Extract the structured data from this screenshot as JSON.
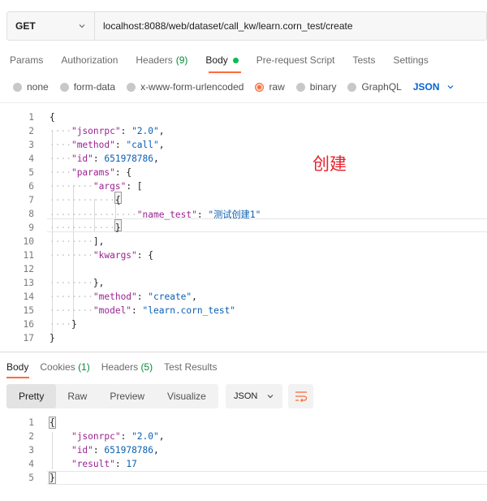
{
  "request": {
    "method": "GET",
    "url": "localhost:8088/web/dataset/call_kw/learn.corn_test/create"
  },
  "request_tabs": [
    {
      "label": "Params"
    },
    {
      "label": "Authorization"
    },
    {
      "label": "Headers",
      "count": "(9)"
    },
    {
      "label": "Body"
    },
    {
      "label": "Pre-request Script"
    },
    {
      "label": "Tests"
    },
    {
      "label": "Settings"
    }
  ],
  "body_types": {
    "none": "none",
    "form_data": "form-data",
    "urlencoded": "x-www-form-urlencoded",
    "raw": "raw",
    "binary": "binary",
    "graphql": "GraphQL",
    "language": "JSON"
  },
  "request_body": {
    "line_numbers": [
      "1",
      "2",
      "3",
      "4",
      "5",
      "6",
      "7",
      "8",
      "9",
      "10",
      "11",
      "12",
      "13",
      "14",
      "15",
      "16",
      "17"
    ],
    "jsonrpc_key": "\"jsonrpc\"",
    "jsonrpc_val": "\"2.0\"",
    "method_key": "\"method\"",
    "method_val": "\"call\"",
    "id_key": "\"id\"",
    "id_val": "651978786",
    "params_key": "\"params\"",
    "args_key": "\"args\"",
    "name_test_key": "\"name_test\"",
    "name_test_val": "\"测试创建1\"",
    "kwargs_key": "\"kwargs\"",
    "inner_method_key": "\"method\"",
    "inner_method_val": "\"create\"",
    "model_key": "\"model\"",
    "model_val": "\"learn.corn_test\""
  },
  "annotation": "创建",
  "response_tabs": [
    {
      "label": "Body"
    },
    {
      "label": "Cookies",
      "count": "(1)"
    },
    {
      "label": "Headers",
      "count": "(5)"
    },
    {
      "label": "Test Results"
    }
  ],
  "response_toolbar": {
    "views": [
      "Pretty",
      "Raw",
      "Preview",
      "Visualize"
    ],
    "format": "JSON"
  },
  "response_body": {
    "line_numbers": [
      "1",
      "2",
      "3",
      "4",
      "5"
    ],
    "jsonrpc_key": "\"jsonrpc\"",
    "jsonrpc_val": "\"2.0\"",
    "id_key": "\"id\"",
    "id_val": "651978786",
    "result_key": "\"result\"",
    "result_val": "17"
  },
  "colors": {
    "accent": "#ff6c37",
    "annotation": "#e8222d",
    "link_blue": "#0265d2",
    "success_green": "#0cbb52"
  }
}
